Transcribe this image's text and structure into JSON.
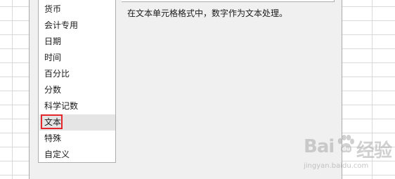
{
  "dialog": {
    "categories": [
      {
        "label": "货币",
        "selected": false
      },
      {
        "label": "会计专用",
        "selected": false
      },
      {
        "label": "日期",
        "selected": false
      },
      {
        "label": "时间",
        "selected": false
      },
      {
        "label": "百分比",
        "selected": false
      },
      {
        "label": "分数",
        "selected": false
      },
      {
        "label": "科学记数",
        "selected": false
      },
      {
        "label": "文本",
        "selected": true
      },
      {
        "label": "特殊",
        "selected": false
      },
      {
        "label": "自定义",
        "selected": false
      }
    ],
    "description": "在文本单元格格式中，数字作为文本处理。"
  },
  "watermark": {
    "brand_left": "Bai",
    "brand_right": "经验",
    "url": "jingyan.baidu.com"
  }
}
